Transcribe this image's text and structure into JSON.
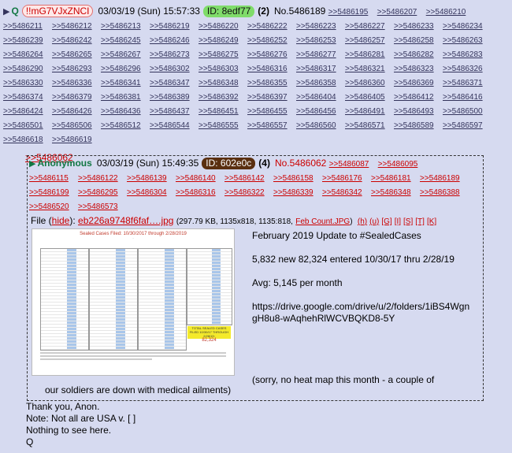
{
  "post": {
    "name": "Q",
    "trip": "!!mG7VJxZNCI",
    "date": "03/03/19 (Sun) 15:57:33",
    "id_label": "ID: 8edf77",
    "reply_count": "(2)",
    "post_no": "No.5486189",
    "backlinks": [
      ">>5486195",
      ">>5486207",
      ">>5486210",
      ">>5486211",
      ">>5486212",
      ">>5486213",
      ">>5486219",
      ">>5486220",
      ">>5486222",
      ">>5486223",
      ">>5486227",
      ">>5486233",
      ">>5486234",
      ">>5486239",
      ">>5486242",
      ">>5486245",
      ">>5486246",
      ">>5486249",
      ">>5486252",
      ">>5486253",
      ">>5486257",
      ">>5486258",
      ">>5486263",
      ">>5486264",
      ">>5486265",
      ">>5486267",
      ">>5486273",
      ">>5486275",
      ">>5486276",
      ">>5486277",
      ">>5486281",
      ">>5486282",
      ">>5486283",
      ">>5486290",
      ">>5486293",
      ">>5486296",
      ">>5486302",
      ">>5486303",
      ">>5486316",
      ">>5486317",
      ">>5486321",
      ">>5486323",
      ">>5486326",
      ">>5486330",
      ">>5486336",
      ">>5486341",
      ">>5486347",
      ">>5486348",
      ">>5486355",
      ">>5486358",
      ">>5486360",
      ">>5486369",
      ">>5486371",
      ">>5486374",
      ">>5486379",
      ">>5486381",
      ">>5486389",
      ">>5486392",
      ">>5486397",
      ">>5486404",
      ">>5486405",
      ">>5486412",
      ">>5486416",
      ">>5486424",
      ">>5486426",
      ">>5486436",
      ">>5486437",
      ">>5486451",
      ">>5486455",
      ">>5486456",
      ">>5486491",
      ">>5486493",
      ">>5486500",
      ">>5486501",
      ">>5486506",
      ">>5486512",
      ">>5486544",
      ">>5486555",
      ">>5486557",
      ">>5486560",
      ">>5486571",
      ">>5486589",
      ">>5486597",
      ">>5486618",
      ">>5486619"
    ],
    "quote_ref": ">>5486062",
    "body_lines": [
      "Thank you, Anon.",
      "Note: Not all are USA v. [       ]",
      "Nothing to see here.",
      "Q"
    ]
  },
  "quoted": {
    "name": "Anonymous",
    "date": "03/03/19 (Sun) 15:49:35",
    "id_label": "ID: 602e0c",
    "reply_count": "(4)",
    "post_no": "No.5486062",
    "backlinks": [
      ">>5486087",
      ">>5486095",
      ">>5486115",
      ">>5486122",
      ">>5486139",
      ">>5486140",
      ">>5486142",
      ">>5486158",
      ">>5486176",
      ">>5486181",
      ">>5486189",
      ">>5486199",
      ">>5486295",
      ">>5486304",
      ">>5486316",
      ">>5486322",
      ">>5486339",
      ">>5486342",
      ">>5486348",
      ">>5486388",
      ">>5486520",
      ">>5486573"
    ],
    "file_label": "File (",
    "hide_label": "hide",
    "file_close": "):",
    "filename": "eb226a9748f6faf….jpg",
    "file_meta": "(297.79 KB, 1135x818, 1135:818,",
    "orig_name": "Feb Count.JPG",
    "file_tools": [
      "(h)",
      "(u)",
      "[G]",
      "[I]",
      "[S]",
      "[T]",
      "[K]"
    ],
    "thumb_title": "Sealed Cases Filed: 10/30/2017 through 2/28/2019",
    "thumb_total_label": "TOTAL SEALED CASES FILED 10/30/17 THROUGH 2/28/19:",
    "thumb_total": "82,324",
    "text_lines": [
      "February 2019 Update to #SealedCases",
      "5,832 new 82,324 entered 10/30/17 thru 2/28/19",
      "Avg: 5,145 per month",
      "https://drive.google.com/drive/u/2/folders/1iBS4WgngH8u8-wAqhehRlWCVBQKD8-5Y"
    ],
    "tail_a": "(sorry, no heat map this month - a couple of",
    "tail_b": "our soldiers are down with medical ailments)"
  },
  "colors": {
    "background": "#d6daf0",
    "link": "#34345c",
    "quote_red": "#cc0000",
    "name_green": "#117743"
  }
}
